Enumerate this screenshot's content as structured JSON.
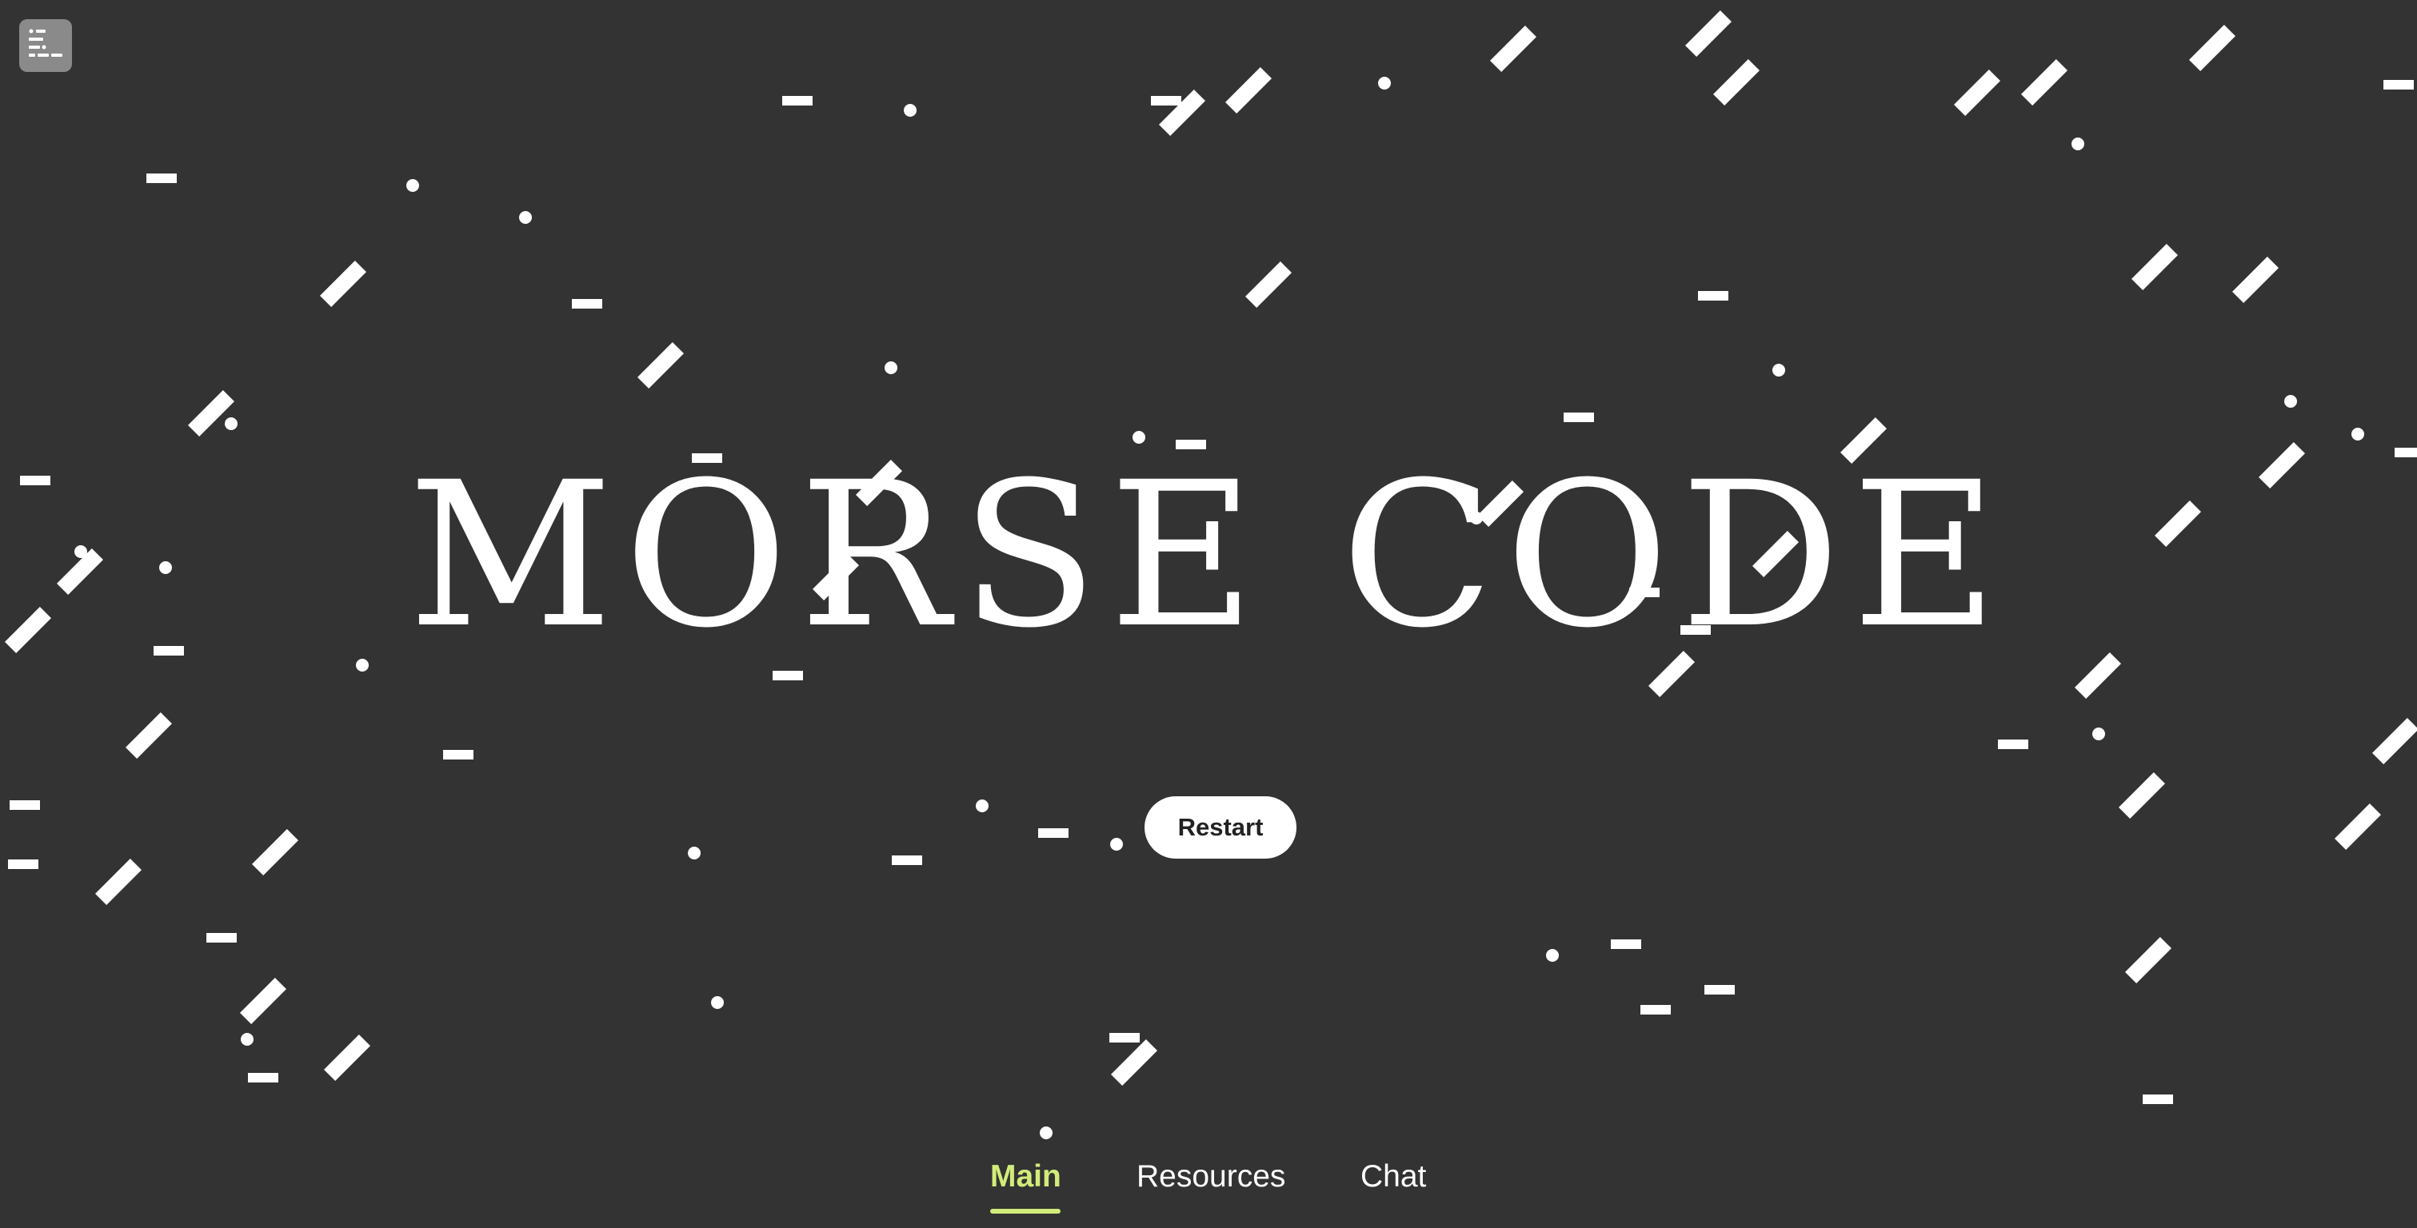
{
  "app": {
    "title": "MORSE CODE",
    "accent_color": "#d2ec7a",
    "background_color": "#333333",
    "foreground_color": "#ffffff"
  },
  "menu_button": {
    "icon": "list-icon"
  },
  "restart_button": {
    "label": "Restart"
  },
  "nav": {
    "tabs": [
      {
        "label": "Main",
        "active": true
      },
      {
        "label": "Resources",
        "active": false
      },
      {
        "label": "Chat",
        "active": false
      }
    ]
  }
}
